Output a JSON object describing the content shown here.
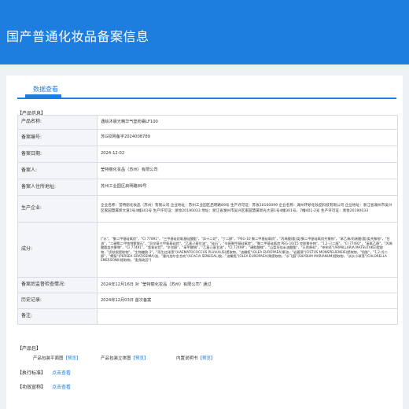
{
  "page_title": "国产普通化妆品备案信息",
  "tab": "数据查看",
  "section_product": "【产品信息】",
  "rows": [
    {
      "label": "产品名称:",
      "value": "遇绘沐晨光精华气垫粉霜LF100"
    },
    {
      "label": "备案编号:",
      "value": "苏G妆网备字2024008789"
    },
    {
      "label": "备案日期:",
      "value": "2024-12-02"
    },
    {
      "label": "备案人:",
      "value": "莹特丽化妆品（苏州）有限公司"
    },
    {
      "label": "备案人住所地址:",
      "value": "苏州工业园区启明路89号"
    },
    {
      "label": "生产企业:",
      "value": "企业名称：莹特丽化妆品（苏州）有限公司 企业地址：苏州工业园区启明路89号 生产许可证：苏妆20160099\n企业名称：湖州环娇化妆品科技有限公司 企业地址：浙江省湖州市吴兴区家园慧属新大道1号4幢301号 生产许可证：浙妆20190033 地址：浙江省湖州市吴兴区家园慧属新光大道1号4幢301号，7幢401-2号 生产许可证：浙妆20190033"
    },
    {
      "label": "成分:",
      "value": "[\"水\"，\"聚二甲基硅氧烷\"，\"CI 77891\"，\"三甲基硅烷氧基硅酸酯\"，\"异十二烷\"，\"丁二醇\"，\"PEG-10 聚二甲基硅氧烷\"，\"丙烯酸(酯)类/聚二甲基硅氧烷共聚物\"，\"苯乙烯/丙烯酸(酯)类共聚物\"，\"甘油\"，\"二硬脂二甲铵锂蒙脱石\"，\"异辛基三甲氧基硅烷\"，\"乙基己基甘油\"，\"硅石\"，\"辛基聚甲基硅氧烷\"，\"聚二甲基硅氧烷 PEG-10/15 交联聚合物\"，\"1,2-己二醇\"，\"CI 77492\"，\"苯氧乙醇\"，\"丙烯酸酯类共聚物\"，\"CI 77491\"，\"氢氧化铝\"，\"辛甘醇\"，\"苯甲酸钠\"，\"乙基己基甘油\"，\"CI 77499\"，\"硬脂酸镁\"，\"山梨坦倍半油酸酯\"，\"天然香料\"，\"茶树花\"(ARMILLARIA MATSUTAKE)提取物，\"虎杖根提取物\"，\"生物糖胶-1\"，\"雨生红球藻\"(HAEMATOCOCCUS PLUVIALIS)提取物，\"油橄榄\"(OLEA EUROPAEA)果油，\"岩蔷薇\"(CISTUS MONSPELIENSIS)提取物，\"肌肽\"，\"1,2-戊二醇\"，\"鳄梨\"(PERSEA GRATISSIMA)油，\"塞内加尔金合欢\"(ACACIA SENEGAL)胶，\"油橄榄\"(OLEA EUROPAEA)果提取物，\"水飞蓟\"(SILYBUM MARIANUM)提取物，\"淡水小球藻\"(CHLORELLA EMERSONII)提取物，\"麦角硫因\"]"
    },
    {
      "label": "备案后监督检查情况:",
      "value": "2024年12月16日 对 “莹特丽化妆品（苏州）有限公司” 通过"
    },
    {
      "label": "历史记录:",
      "value": "2024年12月03日 首次备案"
    },
    {
      "label": "备注:",
      "value": ""
    }
  ],
  "section_package": "【产品包】",
  "packages": [
    {
      "label": "产品包装平面图",
      "link": "【预览】"
    },
    {
      "label": "产品包装立体图",
      "link": "【预览】"
    },
    {
      "label": "内置说明书",
      "link": "【预览】"
    }
  ],
  "standard_label": "【执行标准】",
  "standard_link": "点击查看",
  "efficacy_label": "【功效宣称】",
  "efficacy_link": "点击查看"
}
